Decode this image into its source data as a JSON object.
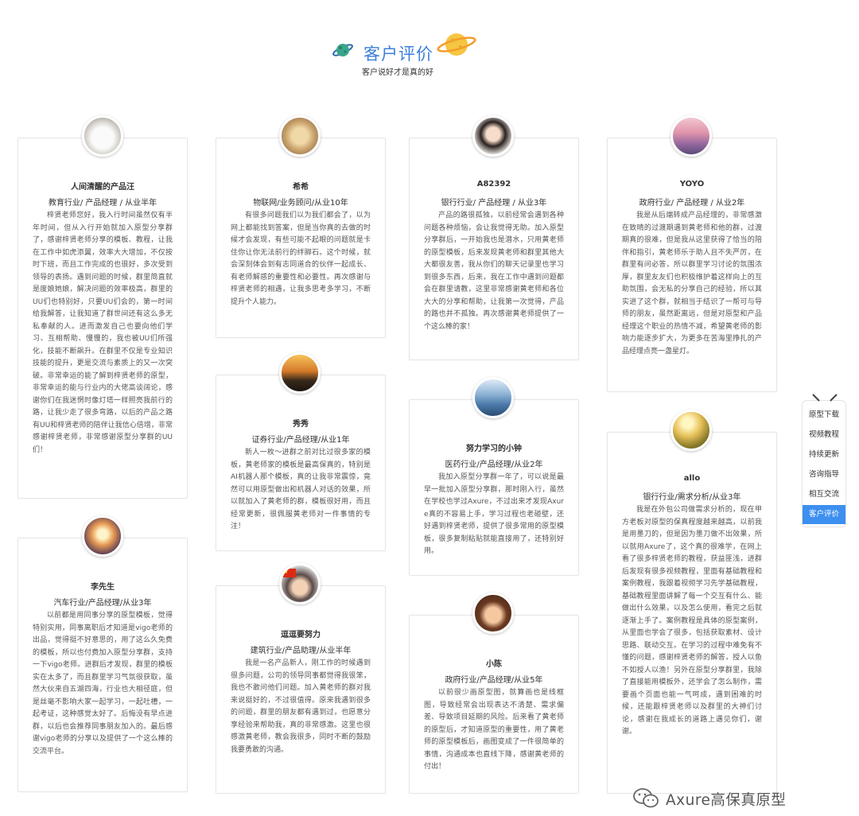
{
  "header": {
    "title": "客户评价",
    "subtitle": "客户说好才是真的好"
  },
  "cards": [
    {
      "name": "人间清醒的产品汪",
      "meta": "教育行业/ 产品经理 / 从业半年",
      "text": "梓贤老师您好，我入行时间虽然仅有半年时间，但从入行开始就加入原型分享群了，感谢梓贤老师分享的模板、教程，让我在工作中如虎添翼，效率大大增加，不仅按时下班，而且工作完成的也很好，多次受到领导的表扬。遇到问题的时候，群里简直就是度娘她娘，解决问题的效率极高，群里的UU们也特别好，只要UU们会的，第一时间给我解答，让我知道了群世间还有这么多无私奉献的人。进而激发自己也要向他们学习、互相帮助、慢慢的，我也被UU们所强化，技能不断飙升。在群里不仅是专业知识技能的提升，更是交流与素质上的又一次突破。非常幸运的能了解到梓贤老师的原型，非常幸运的能与行业内的大佬高谈阔论，感谢你们在我迷惘时像灯塔一样照亮我前行的路，让我少走了很多弯路，以后的产品之路有UU和梓贤老师的陪伴让我信心倍增，非常感谢梓贤老师，非常感谢原型分享群的UU们！"
    },
    {
      "name": "希希",
      "meta": "物联网/业务顾问/从业10年",
      "text": "有很多问题我们以为我们都会了，以为网上都能找到答案，但是当你真的去做的时候才会发现，有些可能不起眼的问题就是卡住你让你无法前行的绊脚石。这个时候，就会深刻体会到有志同道合的伙伴一起成长、有老师解惑的重要性和必要性。再次感谢与梓贤老师的相遇，让我多思考多学习，不断提升个人能力。"
    },
    {
      "name": "A82392",
      "meta": "银行行业/ 产品经理 / 从业3年",
      "text": "产品的路很孤独，以前经常会遇到各种问题各种烦恼，会让我觉得无助。加入原型分享群后，一开始我也是潜水，只用黄老师的原型模板，后来发现黄老师和群里其他大大都很友善，我从你们的聊天记录里也学习到很多东西，后来，我在工作中遇到问题都会在群里请教，这里非常感谢黄老师和各位大大的分享和帮助，让我第一次觉得，产品的路也并不孤独。再次感谢黄老师提供了一个这么棒的家！"
    },
    {
      "name": "YOYO",
      "meta": "政府行业/ 产品经理 / 从业2年",
      "text": "我是从后端转成产品经理的，非常感激在致晴的过渡期遇到黄老师和他的群，过渡期真的很难，但是我从这里获得了恰当的陪伴和指引，黄老师乐于助人且不失严厉，在群里有问必答，所以群里学习讨论的氛围浓厚，群里友友们也积极维护着这样向上的互助氛围，会无私的分享自己的经验，所以其实进了这个群，就相当于结识了一帮可与导师的朋友，虽然距离远，但是对原型和产品经理这个职业的热情不减，希望黄老师的影响力能逐步扩大，为更多在苦海里挣扎的产品经理点亮一盏星灯。"
    },
    {
      "name": "秀秀",
      "meta": "证券行业/产品经理/从业1年",
      "text": "新人一枚～进群之前对比过很多家的模板，黄老师家的模板是最高保真的，特别是AI机器人那个模板，真的让我非常震惊，竟然可以用原型做出和机器人对话的效果，所以就加入了黄老师的群，模板很好用，而且经常更新，很佩服黄老师对一件事情的专注！"
    },
    {
      "name": "努力学习的小钟",
      "meta": "医药行业/产品经理/从业2年",
      "text": "我加入原型分享群一年了，可以说是最早一批加入原型分享群，那时刚入行，虽然在学校也学过Axure，不过出来才发现Axure真的不容易上手，学习过程也老碰壁，还好遇到梓贤老师，提供了很多常用的原型模板，很多复制粘贴就能直接用了，还特别好用。"
    },
    {
      "name": "allo",
      "meta": "银行行业/需求分析/从业3年",
      "text": "我是在外包公司做需求分析的，现在甲方老板对原型的保真程度越来越高，以前我是用墨刀的，但是因为墨刀做不出效果，所以就用Axure了，这个真的很难学，在网上看了很多梓贤老师的教程，获益匪浅，进群后发现有很多视频教程，里面有基础教程和案例教程，我跟着视频学习先学基础教程，基础教程里面讲解了每一个交互有什么、能做出什么效果，以及怎么使用，看完之后就逐渐上手了。案例教程是具体的原型案例，从里面也学会了很多，包括获取素材、设计思路、联动交互。在学习的过程中难免有不懂的问题，感谢梓贤老师的解答，授人以鱼不如授人以渔！另外在原型分享群里，我除了直接能用模板外，还学会了怎么制作，需要画个页面也能一气呵成，遇到困难的时候，还能跟梓贤老师以及群里的大神们讨论，感谢在我成长的道路上遇见你们，谢谢。"
    },
    {
      "name": "李先生",
      "meta": "汽车行业/产品经理/从业3年",
      "text": "以前都是用同事分享的原型模板，觉得特别实用，同事离职后才知道是vigo老师的出品，觉得挺不好意思的，用了这么久免费的模板，所以也付费加入原型分享群，支持一下vigo老师。进群后才发现，群里的模板实在太多了，而且群里学习气氛很获取，虽然大伙来自五湖四海，行业也大相径庭，但是丝毫不影响大家一起学习，一起吐槽，一起考证，这种感觉太好了。后悔没有早点进群，以后也会推荐同事朋友加入的。最后感谢vigo老师的分享以及提供了一个这么棒的交流平台。"
    },
    {
      "name": "逗逗要努力",
      "meta": "建筑行业/产品助理/从业半年",
      "text": "我是一名产品新人，刚工作的时候遇到很多问题，公司的领导同事都觉得我很笨，我也不敢问他们问题。加入黄老师的群对我来说挺好的，不过很值得。原来我遇到很多的问题，群里的朋友都有遇到过，也愿意分享经验来帮助我，真的非常感激。这里也很感激黄老师，教会我很多，同时不断的鼓励我要勇敢的沟通。"
    },
    {
      "name": "小陈",
      "meta": "政府行业/产品经理/从业5年",
      "text": "以前很少画原型图，就算画也是线框图，导致经常会出现表达不清楚、需求偏差、导致项目延期的风险。后来看了黄老师的原型后，才知道原型的重要性，用了黄老师的原型模板后，画图变成了一件很简单的事情，沟通成本也直线下降，感谢黄老师的付出！"
    }
  ],
  "side_nav": {
    "items": [
      "原型下载",
      "视频教程",
      "持续更新",
      "咨询指导",
      "相互交流",
      "客户评价"
    ],
    "active": "客户评价"
  },
  "watermark": {
    "text": "Axure高保真原型"
  },
  "colors": {
    "accent": "#3d7fd8",
    "active_nav": "#3d8ff0"
  }
}
